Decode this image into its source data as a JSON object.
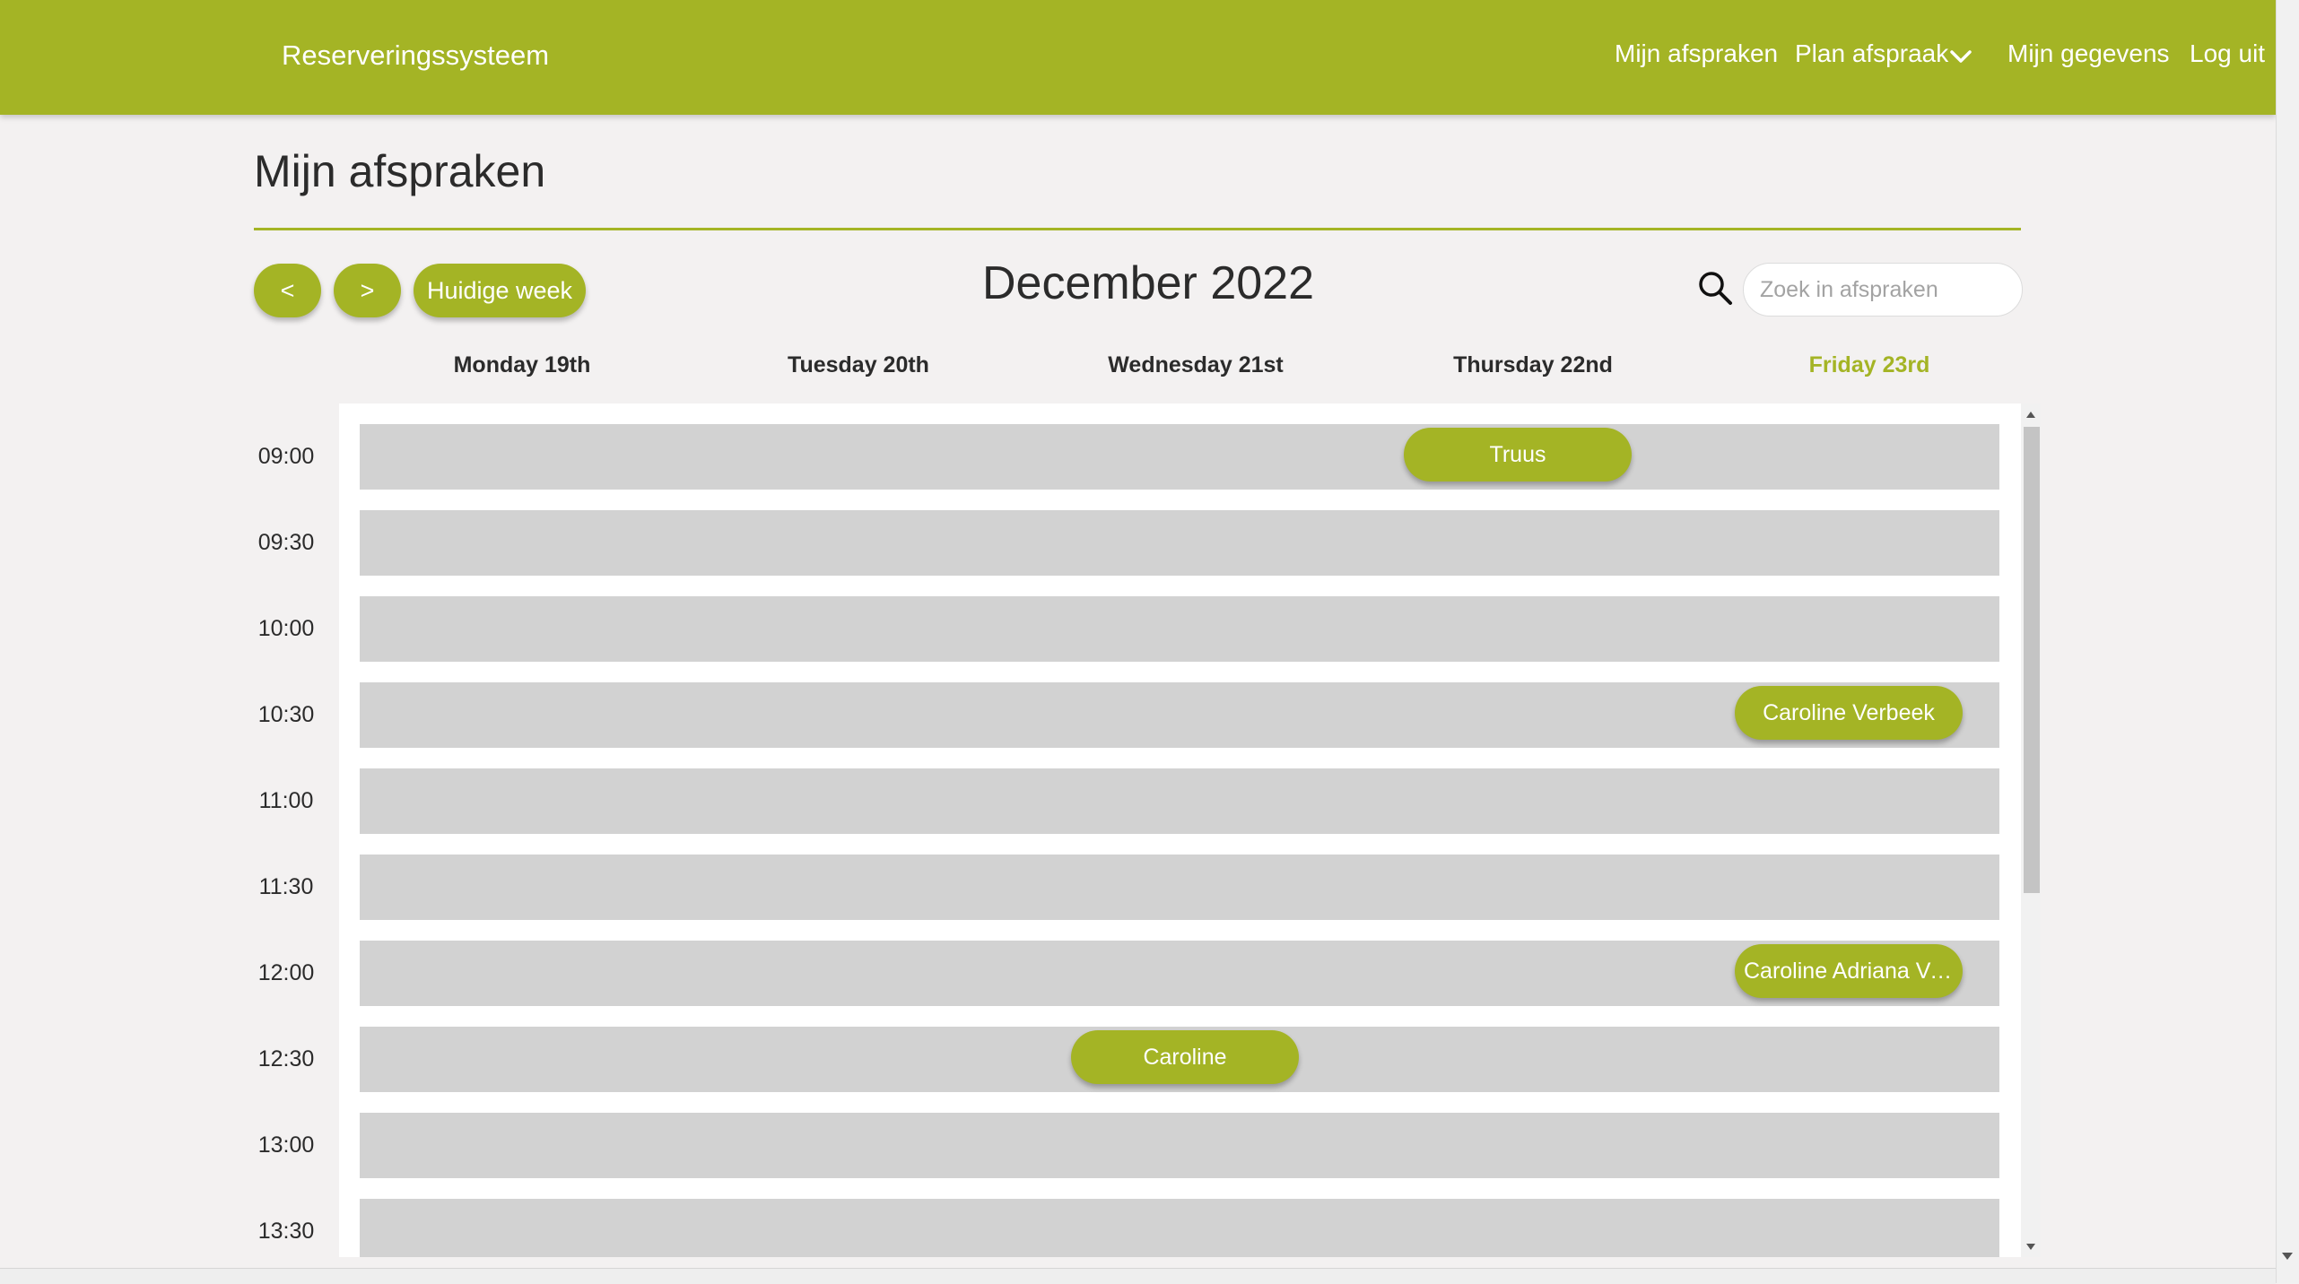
{
  "nav": {
    "brand": "Reserveringssysteem",
    "links": {
      "my_appointments": "Mijn afspraken",
      "plan_appointment": "Plan afspraak",
      "my_details": "Mijn gegevens",
      "logout": "Log uit"
    }
  },
  "page": {
    "title": "Mijn afspraken"
  },
  "toolbar": {
    "prev_label": "<",
    "next_label": ">",
    "current_week_label": "Huidige week",
    "month_label": "December 2022",
    "search_placeholder": "Zoek in afspraken"
  },
  "calendar": {
    "days": [
      {
        "label": "Monday 19th",
        "is_today": false
      },
      {
        "label": "Tuesday 20th",
        "is_today": false
      },
      {
        "label": "Wednesday 21st",
        "is_today": false
      },
      {
        "label": "Thursday 22nd",
        "is_today": false
      },
      {
        "label": "Friday 23rd",
        "is_today": true
      }
    ],
    "times": [
      "09:00",
      "09:30",
      "10:00",
      "10:30",
      "11:00",
      "11:30",
      "12:00",
      "12:30",
      "13:00",
      "13:30"
    ],
    "appointments": [
      {
        "name": "Truus",
        "day": "Thursday 22nd",
        "time": "09:00"
      },
      {
        "name": "Caroline Verbeek",
        "day": "Friday 23rd",
        "time": "10:30"
      },
      {
        "name": "Caroline Adriana Ve…",
        "day": "Friday 23rd",
        "time": "12:00"
      },
      {
        "name": "Caroline",
        "day": "Wednesday 21st",
        "time": "12:30"
      }
    ]
  },
  "colors": {
    "accent": "#a4b425",
    "slot": "#d2d2d2",
    "background": "#f3f1f1"
  }
}
